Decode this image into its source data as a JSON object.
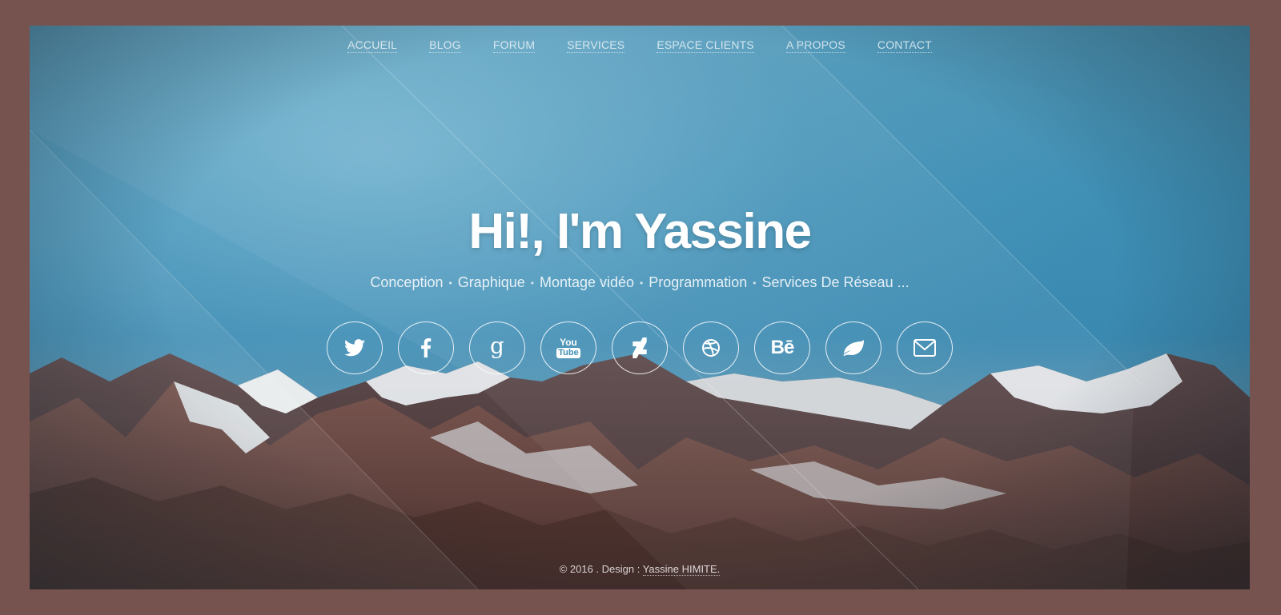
{
  "nav": {
    "items": [
      {
        "label": "ACCUEIL"
      },
      {
        "label": "BLOG"
      },
      {
        "label": "FORUM"
      },
      {
        "label": "SERVICES"
      },
      {
        "label": "ESPACE CLIENTS"
      },
      {
        "label": "A PROPOS"
      },
      {
        "label": "CONTACT"
      }
    ]
  },
  "hero": {
    "title": "Hi!, I'm Yassine",
    "skills": [
      "Conception",
      "Graphique",
      "Montage vidéo",
      "Programmation",
      "Services De Réseau ..."
    ],
    "separator": "•"
  },
  "social": [
    {
      "icon": "twitter-icon"
    },
    {
      "icon": "facebook-icon"
    },
    {
      "icon": "google-icon",
      "glyph": "g"
    },
    {
      "icon": "youtube-icon",
      "glyph_top": "You",
      "glyph_bottom": "Tube"
    },
    {
      "icon": "deviantart-icon"
    },
    {
      "icon": "dribbble-icon"
    },
    {
      "icon": "behance-icon",
      "glyph": "Bē"
    },
    {
      "icon": "leaf-icon"
    },
    {
      "icon": "email-icon"
    }
  ],
  "footer": {
    "copyright": "© 2016 . Design : ",
    "author": "Yassine HIMITE."
  },
  "colors": {
    "border": "#76534e",
    "sky": "#3f8fb5",
    "text": "#ffffff"
  }
}
